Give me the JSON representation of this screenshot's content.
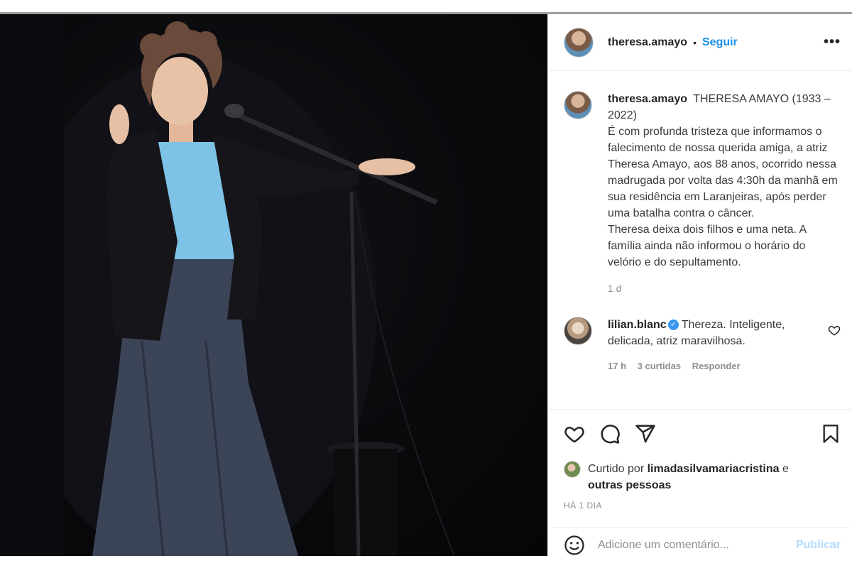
{
  "post": {
    "author": "theresa.amayo",
    "follow_label": "Seguir",
    "separator": "•",
    "more_label": "•••",
    "caption_title": "THERESA AMAYO (1933 – 2022)",
    "caption_paragraph1": "É com profunda tristeza que informamos o falecimento de nossa querida amiga, a atriz Theresa Amayo, aos 88 anos, ocorrido nessa madrugada por volta das 4:30h da manhã em sua residência em Laranjeiras, após perder uma batalha contra o câncer.",
    "caption_paragraph2": "Theresa deixa dois filhos e uma neta. A família ainda não informou o horário do velório e do sepultamento.",
    "caption_time": "1 d"
  },
  "comments": [
    {
      "user": "lilian.blanc",
      "verified": "✓",
      "text": "Thereza. Inteligente, delicada, atriz maravilhosa.",
      "time": "17 h",
      "likes": "3 curtidas",
      "reply": "Responder"
    }
  ],
  "actions": {
    "liked_by_prefix": "Curtido por",
    "liked_by_user": "limadasilvamariacristina",
    "liked_by_and": "e",
    "liked_by_others": "outras pessoas",
    "posted_ago": "HÁ 1 DIA"
  },
  "composer": {
    "placeholder": "Adicione um comentário...",
    "publish_label": "Publicar"
  },
  "icons": [
    "heart-icon",
    "comment-icon",
    "share-icon",
    "bookmark-icon",
    "emoji-icon",
    "more-icon",
    "verified-icon"
  ],
  "colors": {
    "link_blue": "#1a8fe6",
    "publish_disabled": "#b3dbff",
    "muted_text": "#8e8e8e",
    "blouse_blue": "#7ec3e6"
  }
}
